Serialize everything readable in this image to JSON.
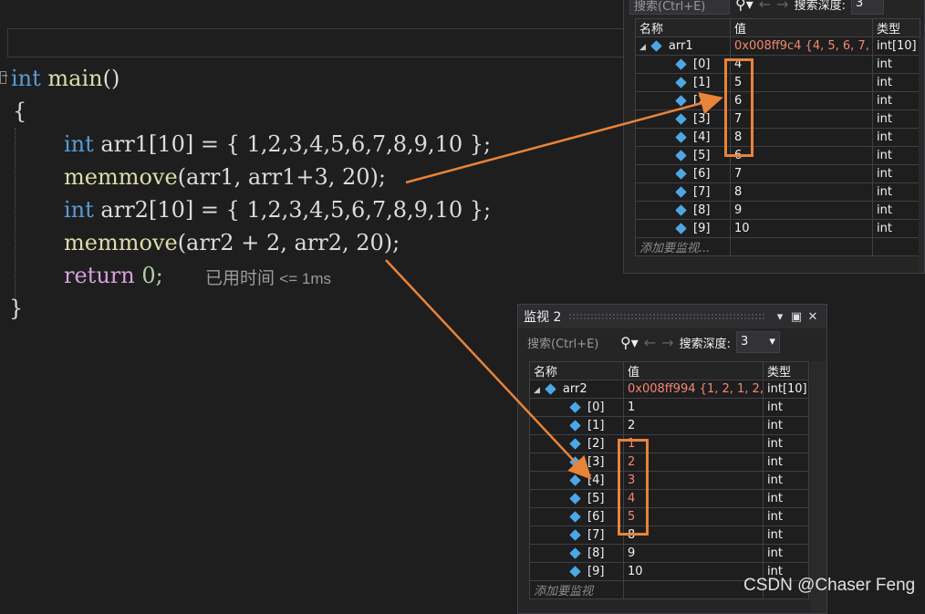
{
  "editor": {
    "code_lines": {
      "line1": {
        "kw": "int",
        "fn": "main",
        "rest": "()"
      },
      "line2": "{",
      "line3": {
        "kw": "int",
        "id": "arr1",
        "rest": "[10] = { 1,2,3,4,5,6,7,8,9,10 };"
      },
      "line4": {
        "fn": "memmove",
        "rest": "(arr1, arr1+3, 20);"
      },
      "line5": {
        "kw": "int",
        "id": "arr2",
        "rest": "[10] = { 1,2,3,4,5,6,7,8,9,10 };"
      },
      "line6": {
        "fn": "memmove",
        "rest": "(arr2 + 2, arr2, 20);"
      },
      "line7": {
        "kw": "return",
        "rest": "0;"
      },
      "line8": "}"
    },
    "perf_tip": "已用时间",
    "perf_value": "<= 1ms"
  },
  "watch1": {
    "search_placeholder": "搜索(Ctrl+E)",
    "search_icon": "search-icon",
    "depth_label": "搜索深度:",
    "depth_value": "3",
    "columns": [
      "名称",
      "值",
      "类型"
    ],
    "parent": {
      "name": "arr1",
      "value": "0x008ff9c4 {4, 5, 6, 7, ...",
      "type": "int[10]"
    },
    "rows": [
      {
        "name": "[0]",
        "value": "4",
        "type": "int"
      },
      {
        "name": "[1]",
        "value": "5",
        "type": "int"
      },
      {
        "name": "[2]",
        "value": "6",
        "type": "int"
      },
      {
        "name": "[3]",
        "value": "7",
        "type": "int"
      },
      {
        "name": "[4]",
        "value": "8",
        "type": "int"
      },
      {
        "name": "[5]",
        "value": "6",
        "type": "int"
      },
      {
        "name": "[6]",
        "value": "7",
        "type": "int"
      },
      {
        "name": "[7]",
        "value": "8",
        "type": "int"
      },
      {
        "name": "[8]",
        "value": "9",
        "type": "int"
      },
      {
        "name": "[9]",
        "value": "10",
        "type": "int"
      }
    ],
    "add_label": "添加要监视..."
  },
  "watch2": {
    "title": "监视 2",
    "search_placeholder": "搜索(Ctrl+E)",
    "depth_label": "搜索深度:",
    "depth_value": "3",
    "columns": [
      "名称",
      "值",
      "类型"
    ],
    "parent": {
      "name": "arr2",
      "value": "0x008ff994 {1, 2, 1, 2,...",
      "type": "int[10]"
    },
    "rows": [
      {
        "name": "[0]",
        "value": "1",
        "type": "int",
        "changed": false
      },
      {
        "name": "[1]",
        "value": "2",
        "type": "int",
        "changed": false
      },
      {
        "name": "[2]",
        "value": "1",
        "type": "int",
        "changed": true
      },
      {
        "name": "[3]",
        "value": "2",
        "type": "int",
        "changed": true
      },
      {
        "name": "[4]",
        "value": "3",
        "type": "int",
        "changed": true
      },
      {
        "name": "[5]",
        "value": "4",
        "type": "int",
        "changed": true
      },
      {
        "name": "[6]",
        "value": "5",
        "type": "int",
        "changed": true
      },
      {
        "name": "[7]",
        "value": "8",
        "type": "int",
        "changed": false
      },
      {
        "name": "[8]",
        "value": "9",
        "type": "int",
        "changed": false
      },
      {
        "name": "[9]",
        "value": "10",
        "type": "int",
        "changed": false
      }
    ],
    "add_label": "添加要监视"
  },
  "watermark": "CSDN @Chaser Feng",
  "colors": {
    "highlight": "#e8833a",
    "changed_value": "#f48771",
    "keyword": "#569cd6",
    "function": "#dcdcaa"
  }
}
